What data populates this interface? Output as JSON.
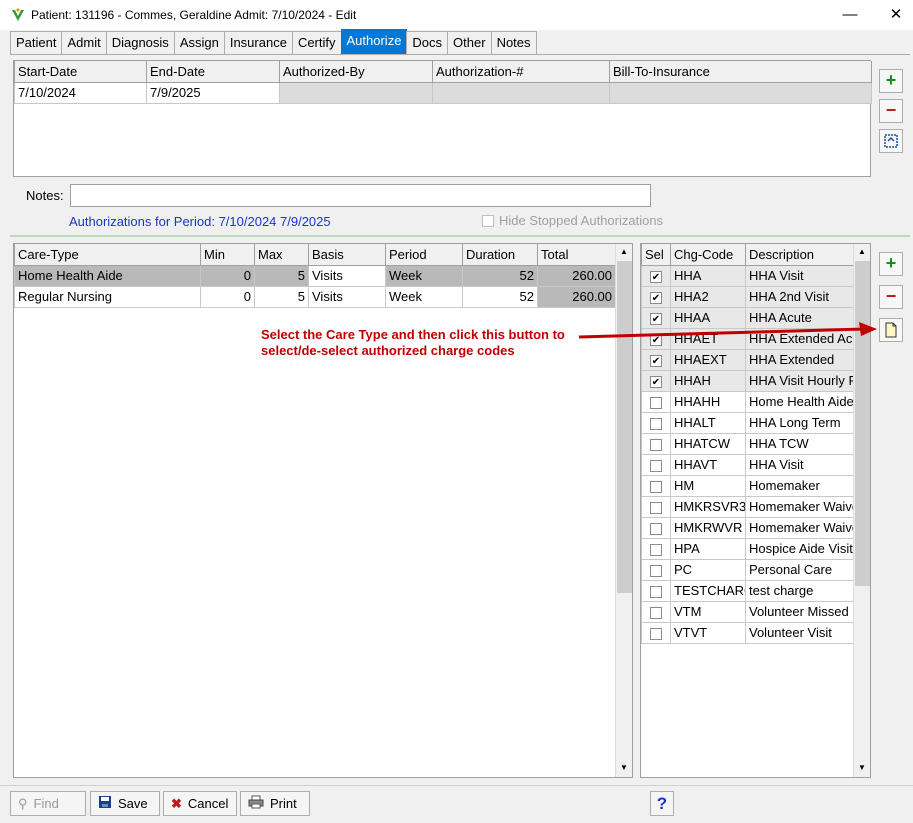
{
  "window": {
    "title": "Patient: 131196 - Commes, Geraldine   Admit: 7/10/2024 - Edit",
    "minimize": "—",
    "close": "✕"
  },
  "tabs": [
    "Patient",
    "Admit",
    "Diagnosis",
    "Assign",
    "Insurance",
    "Certify",
    "Authorize",
    "Docs",
    "Other",
    "Notes"
  ],
  "active_tab": "Authorize",
  "auth_grid": {
    "columns": [
      "Start-Date",
      "End-Date",
      "Authorized-By",
      "Authorization-#",
      "Bill-To-Insurance"
    ],
    "rows": [
      [
        "7/10/2024",
        "7/9/2025",
        "",
        "",
        ""
      ]
    ]
  },
  "notes": {
    "label": "Notes:",
    "value": ""
  },
  "period_label": "Authorizations for Period: 7/10/2024  7/9/2025",
  "hide_stopped": "Hide Stopped Authorizations",
  "care_grid": {
    "columns": [
      "Care-Type",
      "Min",
      "Max",
      "Basis",
      "Period",
      "Duration",
      "Total"
    ],
    "rows": [
      [
        "Home Health Aide",
        "0",
        "5",
        "Visits",
        "Week",
        "52",
        "260.00"
      ],
      [
        "Regular Nursing",
        "0",
        "5",
        "Visits",
        "Week",
        "52",
        "260.00"
      ]
    ]
  },
  "charge_grid": {
    "columns": [
      "Sel",
      "Chg-Code",
      "Description"
    ],
    "rows": [
      {
        "sel": true,
        "code": "HHA",
        "desc": "HHA Visit"
      },
      {
        "sel": true,
        "code": "HHA2",
        "desc": "HHA 2nd Visit"
      },
      {
        "sel": true,
        "code": "HHAA",
        "desc": "HHA Acute"
      },
      {
        "sel": true,
        "code": "HHAET",
        "desc": "HHA Extended Ac"
      },
      {
        "sel": true,
        "code": "HHAEXT",
        "desc": "HHA Extended"
      },
      {
        "sel": true,
        "code": "HHAH",
        "desc": "HHA Visit Hourly R"
      },
      {
        "sel": false,
        "code": "HHAHH",
        "desc": "Home Health Aide"
      },
      {
        "sel": false,
        "code": "HHALT",
        "desc": "HHA Long Term"
      },
      {
        "sel": false,
        "code": "HHATCW",
        "desc": "HHA TCW"
      },
      {
        "sel": false,
        "code": "HHAVT",
        "desc": "HHA Visit"
      },
      {
        "sel": false,
        "code": "HM",
        "desc": "Homemaker"
      },
      {
        "sel": false,
        "code": "HMKRSVR3",
        "desc": "Homemaker Waive"
      },
      {
        "sel": false,
        "code": "HMKRWVR",
        "desc": "Homemaker Waive"
      },
      {
        "sel": false,
        "code": "HPA",
        "desc": "Hospice Aide Visit"
      },
      {
        "sel": false,
        "code": "PC",
        "desc": "Personal Care"
      },
      {
        "sel": false,
        "code": "TESTCHARG",
        "desc": "test charge"
      },
      {
        "sel": false,
        "code": "VTM",
        "desc": "Volunteer Missed"
      },
      {
        "sel": false,
        "code": "VTVT",
        "desc": "Volunteer Visit"
      }
    ]
  },
  "annotation": [
    "Select the Care Type and then click this button to",
    "select/de-select authorized charge codes"
  ],
  "buttons": {
    "find": "Find",
    "save": "Save",
    "cancel": "Cancel",
    "print": "Print",
    "help": "?"
  },
  "colors": {
    "accent": "#0078d7",
    "annotation": "#c00000",
    "add": "#1a8c1a",
    "remove": "#c01818"
  }
}
